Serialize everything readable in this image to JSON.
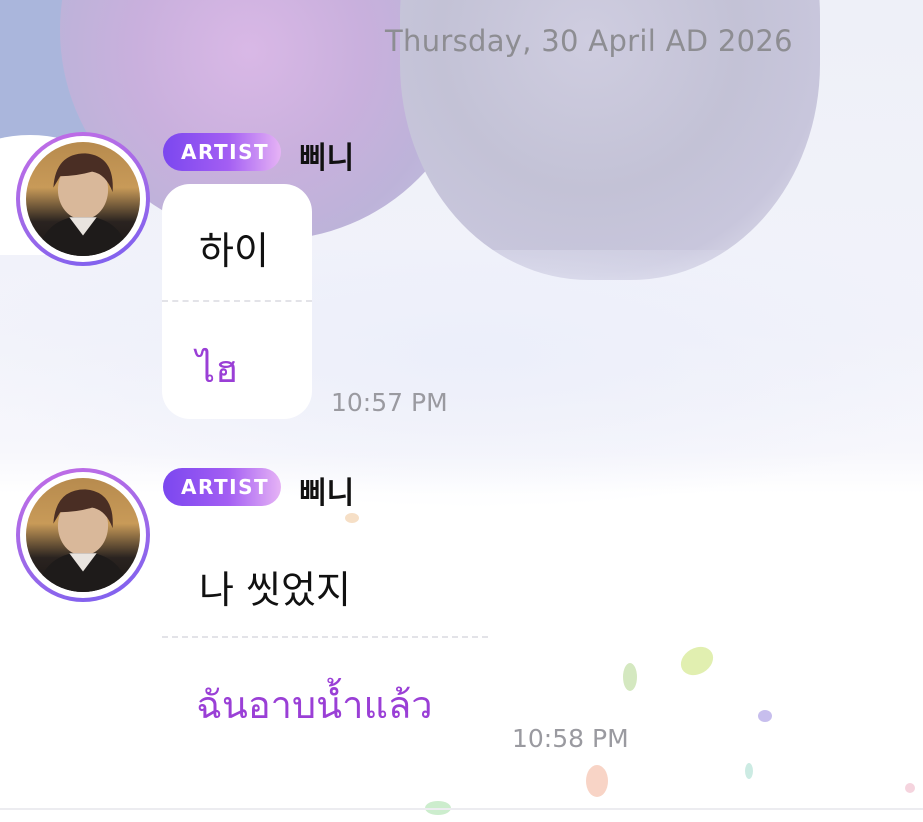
{
  "date_header": "Thursday, 30 April AD 2026",
  "colors": {
    "accent_purple": "#9a3fd6",
    "badge_start": "#7b47ef",
    "badge_end": "#e6b3f5",
    "time_gray": "#9a9aa0"
  },
  "messages": [
    {
      "badge": "ARTIST",
      "sender": "삐니",
      "text": "하이",
      "translation": "ไฮ",
      "time": "10:57 PM",
      "avatar_icon": "artist-avatar"
    },
    {
      "badge": "ARTIST",
      "sender": "삐니",
      "text": "나 씻었지",
      "translation": "ฉันอาบน้ำแล้ว",
      "time": "10:58 PM",
      "avatar_icon": "artist-avatar"
    }
  ]
}
